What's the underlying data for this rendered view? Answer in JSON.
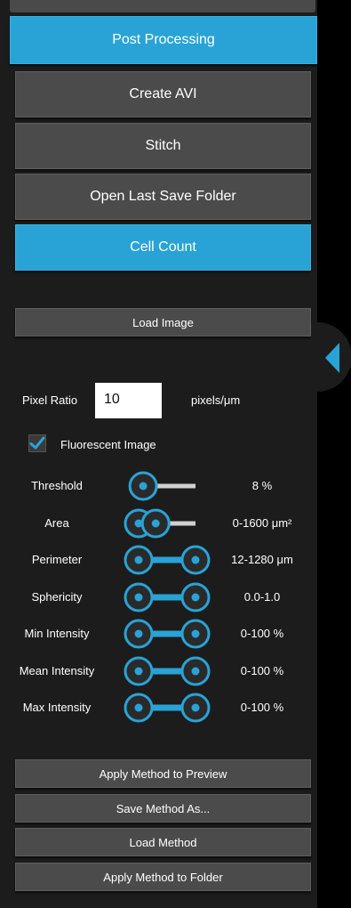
{
  "menu": {
    "post_processing": "Post Processing",
    "create_avi": "Create AVI",
    "stitch": "Stitch",
    "open_last_save_folder": "Open Last Save Folder",
    "cell_count": "Cell Count"
  },
  "cell_count": {
    "load_image": "Load Image",
    "pixel_ratio_label": "Pixel Ratio",
    "pixel_ratio_value": "10",
    "pixel_ratio_unit": "pixels/μm",
    "fluorescent_label": "Fluorescent Image",
    "fluorescent_checked": true,
    "sliders": [
      {
        "label": "Threshold",
        "value": "8 %",
        "type": "single",
        "low": 0.08
      },
      {
        "label": "Area",
        "value": "0-1600 μm²",
        "type": "range",
        "low": 0.0,
        "high": 0.3
      },
      {
        "label": "Perimeter",
        "value": "12-1280 μm",
        "type": "range",
        "low": 0.0,
        "high": 1.0
      },
      {
        "label": "Sphericity",
        "value": "0.0-1.0",
        "type": "range",
        "low": 0.0,
        "high": 1.0
      },
      {
        "label": "Min Intensity",
        "value": "0-100 %",
        "type": "range",
        "low": 0.0,
        "high": 1.0
      },
      {
        "label": "Mean Intensity",
        "value": "0-100 %",
        "type": "range",
        "low": 0.0,
        "high": 1.0
      },
      {
        "label": "Max Intensity",
        "value": "0-100 %",
        "type": "range",
        "low": 0.0,
        "high": 1.0
      }
    ],
    "apply_preview": "Apply Method to Preview",
    "save_method_as": "Save Method As...",
    "load_method": "Load Method",
    "apply_folder": "Apply Method to Folder"
  },
  "colors": {
    "accent": "#29a3d6",
    "panel": "#1c1c1c",
    "button": "#4b4b4b",
    "track": "#d0d0d0"
  },
  "icons": {
    "collapse": "chevron-left-icon",
    "check": "checkmark-icon"
  }
}
